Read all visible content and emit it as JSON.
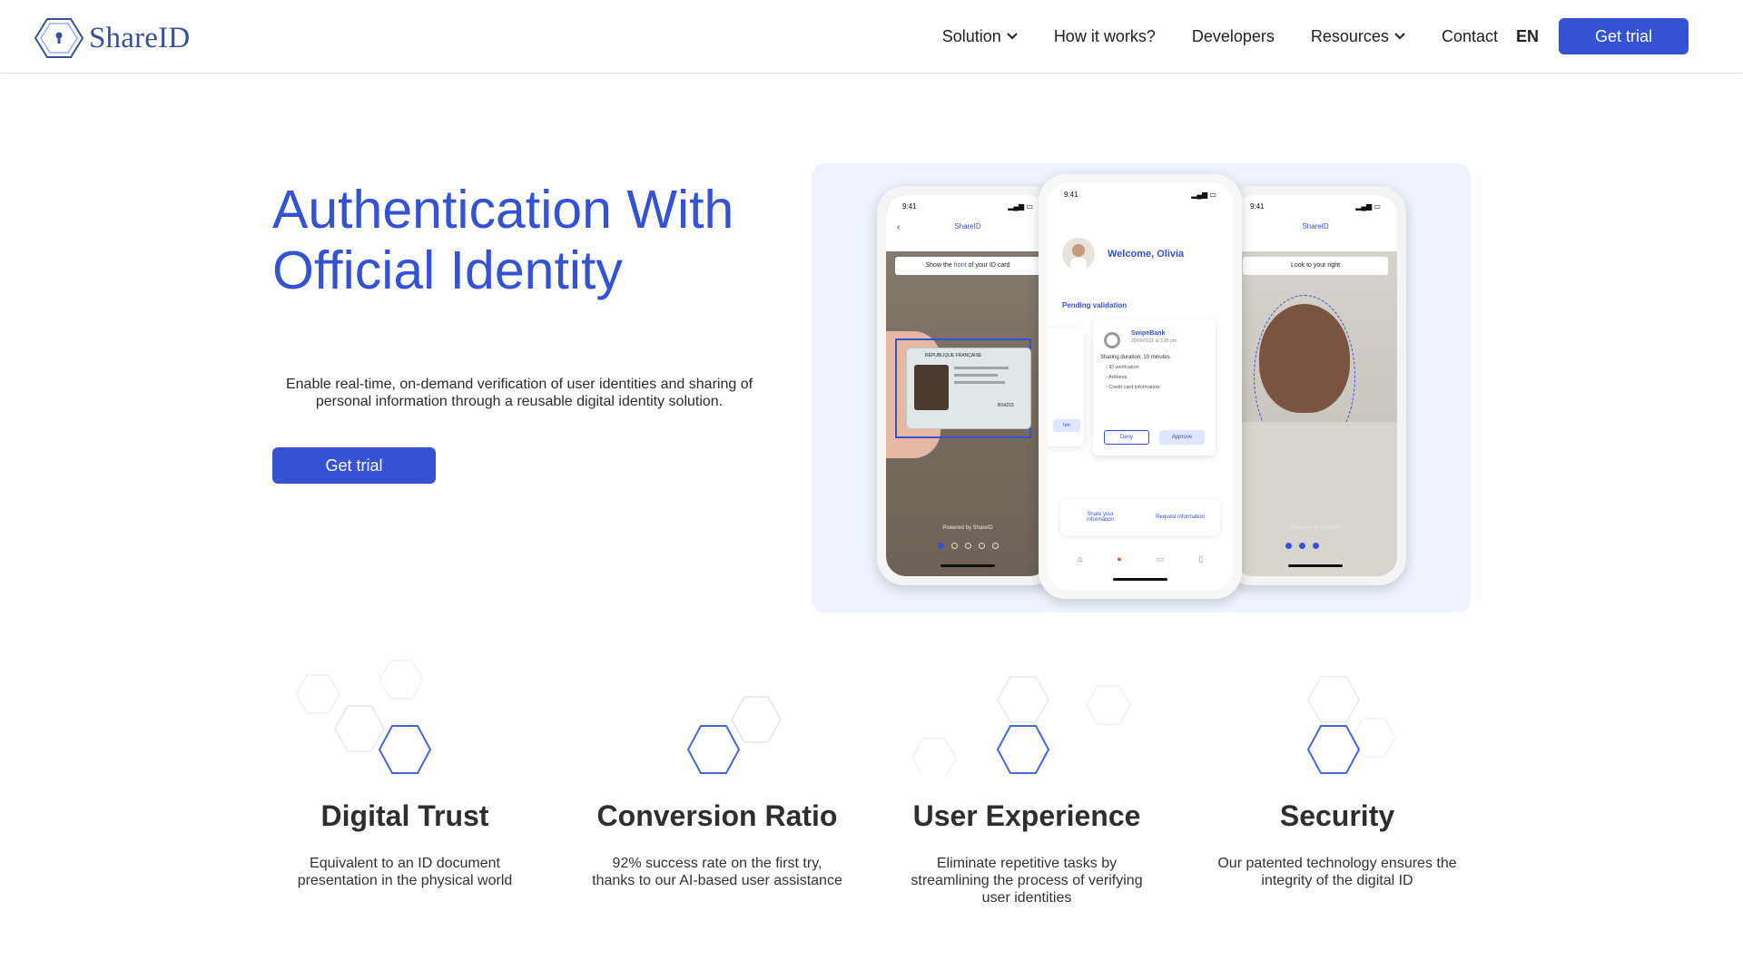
{
  "brand": {
    "name": "ShareID",
    "color": "#3a4f9c",
    "accent": "#3552d4"
  },
  "nav": {
    "items": [
      {
        "label": "Solution",
        "dropdown": true,
        "icon": "chevron-down-icon"
      },
      {
        "label": "How it works?",
        "dropdown": false
      },
      {
        "label": "Developers",
        "dropdown": false
      },
      {
        "label": "Resources",
        "dropdown": true,
        "icon": "chevron-down-icon"
      },
      {
        "label": "Contact",
        "dropdown": false
      }
    ],
    "language": "EN",
    "cta": "Get trial"
  },
  "hero": {
    "title_line1": "Authentication With",
    "title_line2": "Official Identity",
    "description": "Enable real-time, on-demand verification of user identities and sharing of personal information through a reusable digital identity solution.",
    "cta": "Get trial"
  },
  "mockups": {
    "time": "9:41",
    "app_name": "ShareID",
    "left": {
      "instruction_pre": "Show the ",
      "instruction_em": "front",
      "instruction_post": " of your ID card",
      "id_header": "RÉPUBLIQUE FRANÇAISE",
      "id_number": "BX4215",
      "powered": "Powered by ShareID"
    },
    "middle": {
      "welcome": "Welcome, Olivia",
      "pending": "Pending validation",
      "bank": "SwipeBank",
      "bank_date": "25/09/2021 at 3:25 pm",
      "sharing": "Sharing duration: 10 minutes",
      "bullets": [
        "ID verification",
        "Address",
        "Credit card information"
      ],
      "deny": "Deny",
      "approve": "Approve",
      "ghost_btn": "ive",
      "share_info": "Share your information",
      "request_info": "Request information",
      "tabs": [
        "Home",
        "Notifications",
        "Folder",
        "Wallets"
      ]
    },
    "right": {
      "instruction": "Look to your right",
      "powered": "Powered by ShareID"
    }
  },
  "features": [
    {
      "title": "Digital Trust",
      "description": "Equivalent to an ID document presentation in the physical world"
    },
    {
      "title": "Conversion Ratio",
      "description": "92% success rate on the first try, thanks to our AI-based user assistance"
    },
    {
      "title": "User Experience",
      "description": "Eliminate repetitive tasks by streamlining the process of verifying user identities"
    },
    {
      "title": "Security",
      "description": "Our patented technology ensures the integrity of the digital ID"
    }
  ]
}
